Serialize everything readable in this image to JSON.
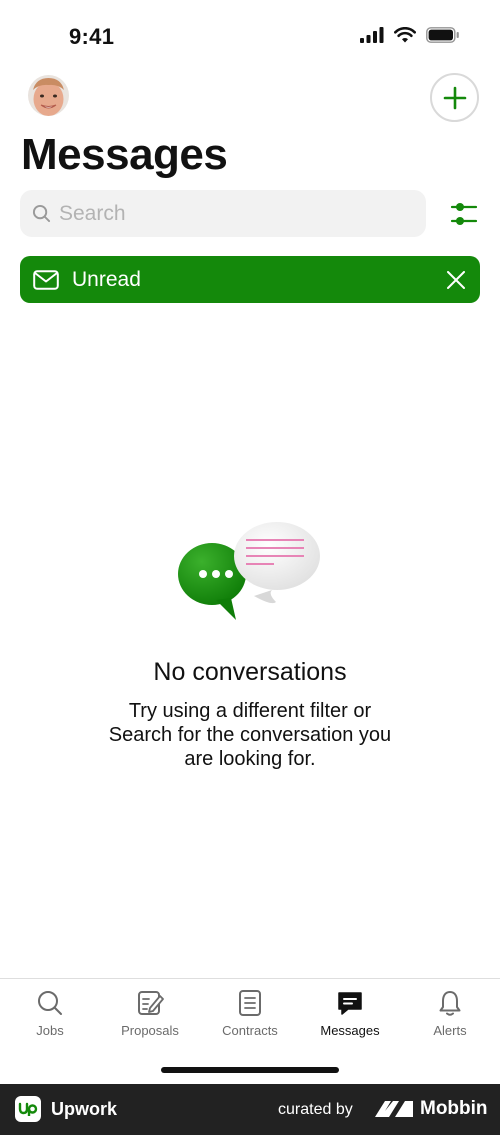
{
  "status_bar": {
    "time": "9:41"
  },
  "header": {
    "title": "Messages"
  },
  "search": {
    "placeholder": "Search",
    "value": ""
  },
  "filter_chip": {
    "label": "Unread"
  },
  "empty_state": {
    "title": "No conversations",
    "description": "Try using a different filter or Search for the conversation you are looking for."
  },
  "tabs": [
    {
      "label": "Jobs",
      "icon": "search-icon",
      "active": false
    },
    {
      "label": "Proposals",
      "icon": "proposals-icon",
      "active": false
    },
    {
      "label": "Contracts",
      "icon": "contracts-icon",
      "active": false
    },
    {
      "label": "Messages",
      "icon": "messages-icon",
      "active": true
    },
    {
      "label": "Alerts",
      "icon": "bell-icon",
      "active": false
    }
  ],
  "footer": {
    "app_name": "Upwork",
    "curated_by": "curated by",
    "brand": "Mobbin"
  },
  "colors": {
    "accent": "#14890b",
    "footer_bg": "#222222"
  }
}
